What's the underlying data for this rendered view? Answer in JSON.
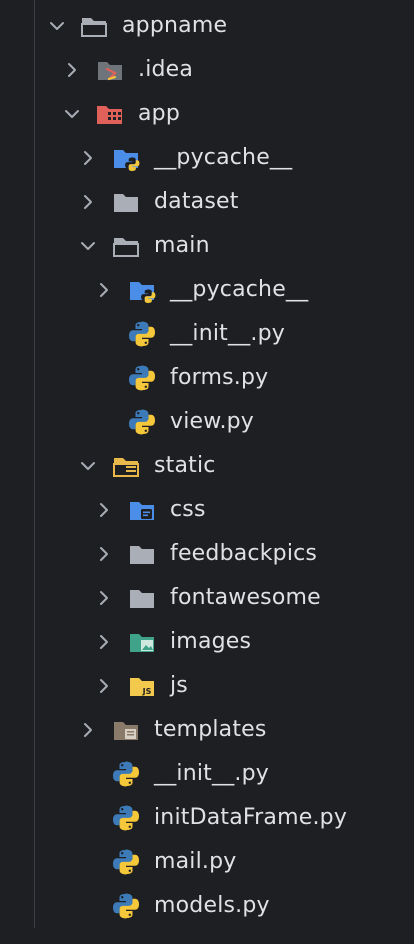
{
  "tree": {
    "root": {
      "label": "appname",
      "icon": "folder-open-icon",
      "expanded": true
    },
    "idea": {
      "label": ".idea",
      "icon": "idea-folder-icon",
      "expanded": false
    },
    "app": {
      "label": "app",
      "icon": "package-folder-icon",
      "expanded": true
    },
    "app_pycache": {
      "label": "__pycache__",
      "icon": "python-folder-icon",
      "expanded": false
    },
    "dataset": {
      "label": "dataset",
      "icon": "folder-icon",
      "expanded": false
    },
    "main": {
      "label": "main",
      "icon": "folder-open-icon",
      "expanded": true
    },
    "main_pycache": {
      "label": "__pycache__",
      "icon": "python-folder-icon",
      "expanded": false
    },
    "main_init": {
      "label": "__init__.py",
      "icon": "python-file-icon"
    },
    "forms": {
      "label": "forms.py",
      "icon": "python-file-icon"
    },
    "view": {
      "label": "view.py",
      "icon": "python-file-icon"
    },
    "static": {
      "label": "static",
      "icon": "resources-folder-icon",
      "expanded": true
    },
    "css": {
      "label": "css",
      "icon": "css-folder-icon",
      "expanded": false
    },
    "feedbackpics": {
      "label": "feedbackpics",
      "icon": "folder-icon",
      "expanded": false
    },
    "fontawesome": {
      "label": "fontawesome",
      "icon": "folder-icon",
      "expanded": false
    },
    "images": {
      "label": "images",
      "icon": "images-folder-icon",
      "expanded": false
    },
    "js": {
      "label": "js",
      "icon": "js-folder-icon",
      "expanded": false
    },
    "templates": {
      "label": "templates",
      "icon": "templates-folder-icon",
      "expanded": false
    },
    "app_init": {
      "label": "__init__.py",
      "icon": "python-file-icon"
    },
    "initdataframe": {
      "label": "initDataFrame.py",
      "icon": "python-file-icon"
    },
    "mail": {
      "label": "mail.py",
      "icon": "python-file-icon"
    },
    "models": {
      "label": "models.py",
      "icon": "python-file-icon"
    }
  },
  "colors": {
    "background": "#1e1f22",
    "text": "#dfe1e5",
    "chevron": "#a8adb5",
    "folder_gray": "#a9aeb7",
    "python_blue": "#3d7ab8",
    "python_yellow": "#f5c73b",
    "package_red": "#e0605a",
    "css_blue": "#4a8ee8",
    "js_yellow": "#f2c94c",
    "images_teal": "#3fa38a",
    "templates_brown": "#8a7a6a"
  }
}
